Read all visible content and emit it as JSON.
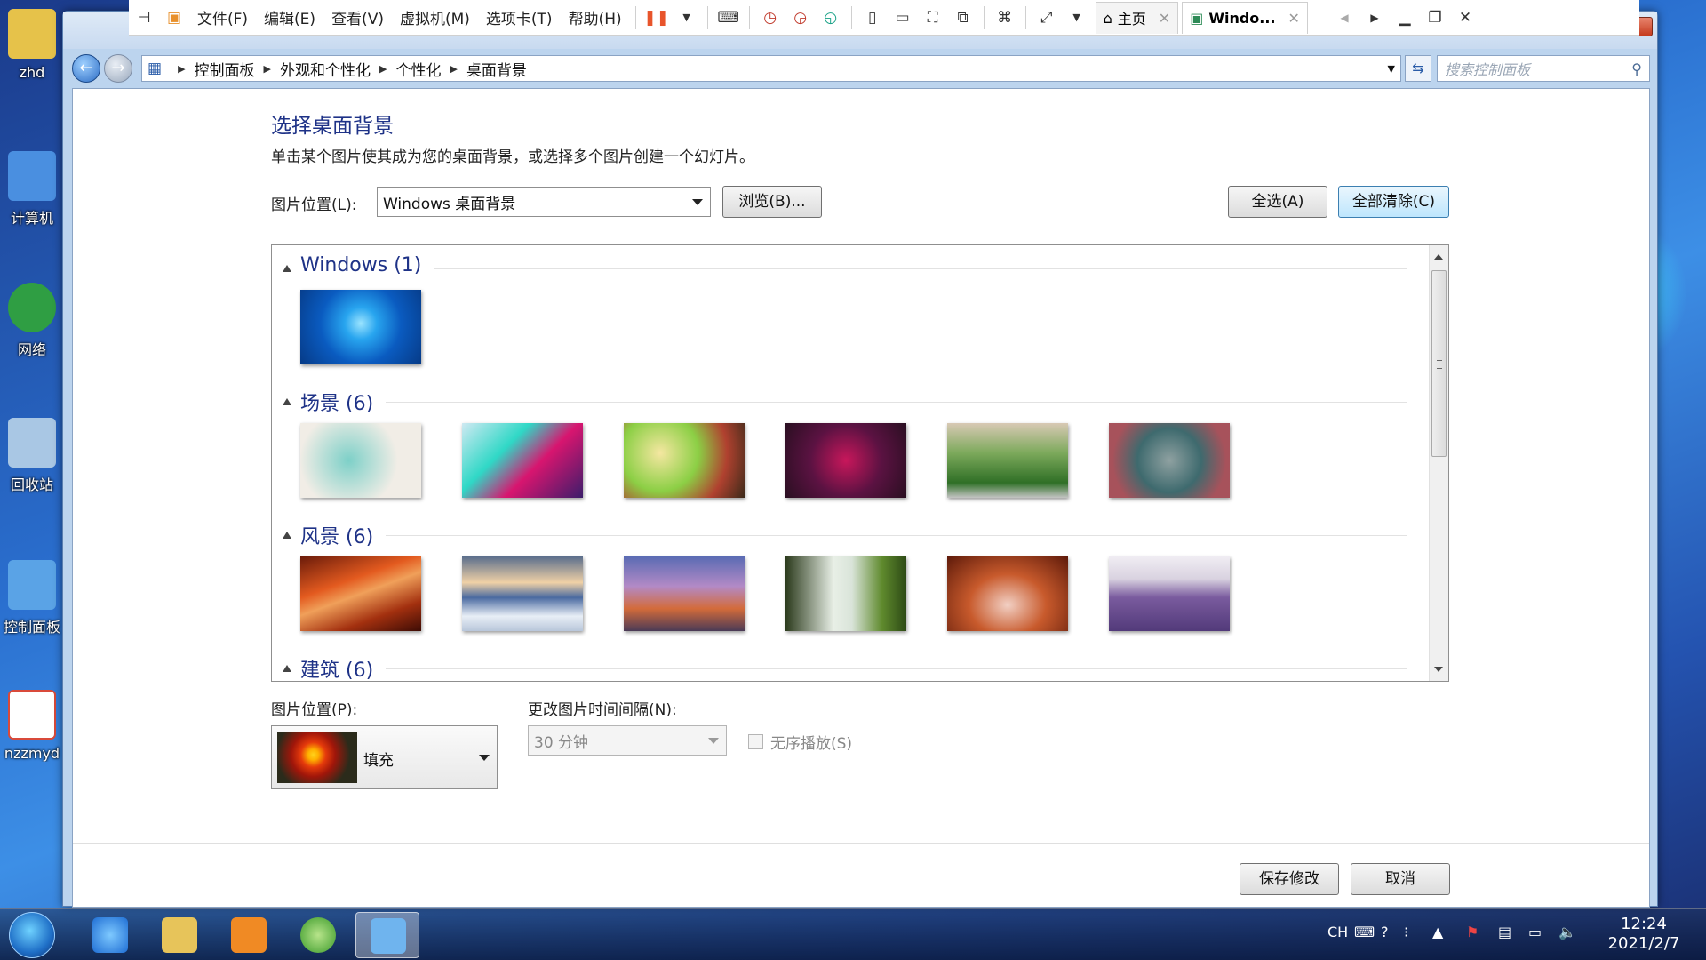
{
  "desktop": {
    "icons": [
      {
        "label": "zhd",
        "color": "#e6c24a"
      },
      {
        "label": "计算机",
        "color": "#4a8fe0"
      },
      {
        "label": "网络",
        "color": "#2f9e43"
      },
      {
        "label": "回收站",
        "color": "#a9c7e4"
      },
      {
        "label": "控制面板",
        "color": "#5aa3e6"
      },
      {
        "label": "nzzmyd",
        "color": "#d94a3a"
      }
    ]
  },
  "vm_toolbar": {
    "menus": [
      "文件(F)",
      "编辑(E)",
      "查看(V)",
      "虚拟机(M)",
      "选项卡(T)",
      "帮助(H)"
    ],
    "tabs": [
      {
        "label": "主页",
        "active": false
      },
      {
        "label": "Windo...",
        "active": true
      }
    ]
  },
  "addressbar": {
    "breadcrumbs": [
      "控制面板",
      "外观和个性化",
      "个性化",
      "桌面背景"
    ],
    "search_placeholder": "搜索控制面板"
  },
  "page": {
    "title": "选择桌面背景",
    "description": "单击某个图片使其成为您的桌面背景，或选择多个图片创建一个幻灯片。",
    "location_label": "图片位置(L):",
    "location_value": "Windows 桌面背景",
    "browse_label": "浏览(B)...",
    "select_all_label": "全选(A)",
    "clear_all_label": "全部清除(C)"
  },
  "gallery": {
    "groups": [
      {
        "title": "Windows (1)",
        "thumbs": [
          "windows-7-default"
        ]
      },
      {
        "title": "场景 (6)",
        "thumbs": [
          "scene-1",
          "scene-2",
          "scene-3",
          "scene-4",
          "scene-5",
          "scene-6"
        ]
      },
      {
        "title": "风景 (6)",
        "thumbs": [
          "landscape-canyon",
          "landscape-ice",
          "landscape-coast",
          "landscape-waterfall",
          "landscape-arch",
          "landscape-lavender"
        ]
      },
      {
        "title": "建筑 (6)",
        "thumbs": []
      }
    ]
  },
  "options": {
    "position_label": "图片位置(P):",
    "position_value": "填充",
    "interval_label": "更改图片时间间隔(N):",
    "interval_value": "30 分钟",
    "shuffle_label": "无序播放(S)",
    "shuffle_checked": false
  },
  "footer": {
    "save_label": "保存修改",
    "cancel_label": "取消"
  },
  "taskbar": {
    "tray_lang": "CH",
    "time": "12:24",
    "date": "2021/2/7"
  },
  "colors": {
    "title_blue": "#1e3287",
    "vm_pause_orange": "#e8542b"
  }
}
